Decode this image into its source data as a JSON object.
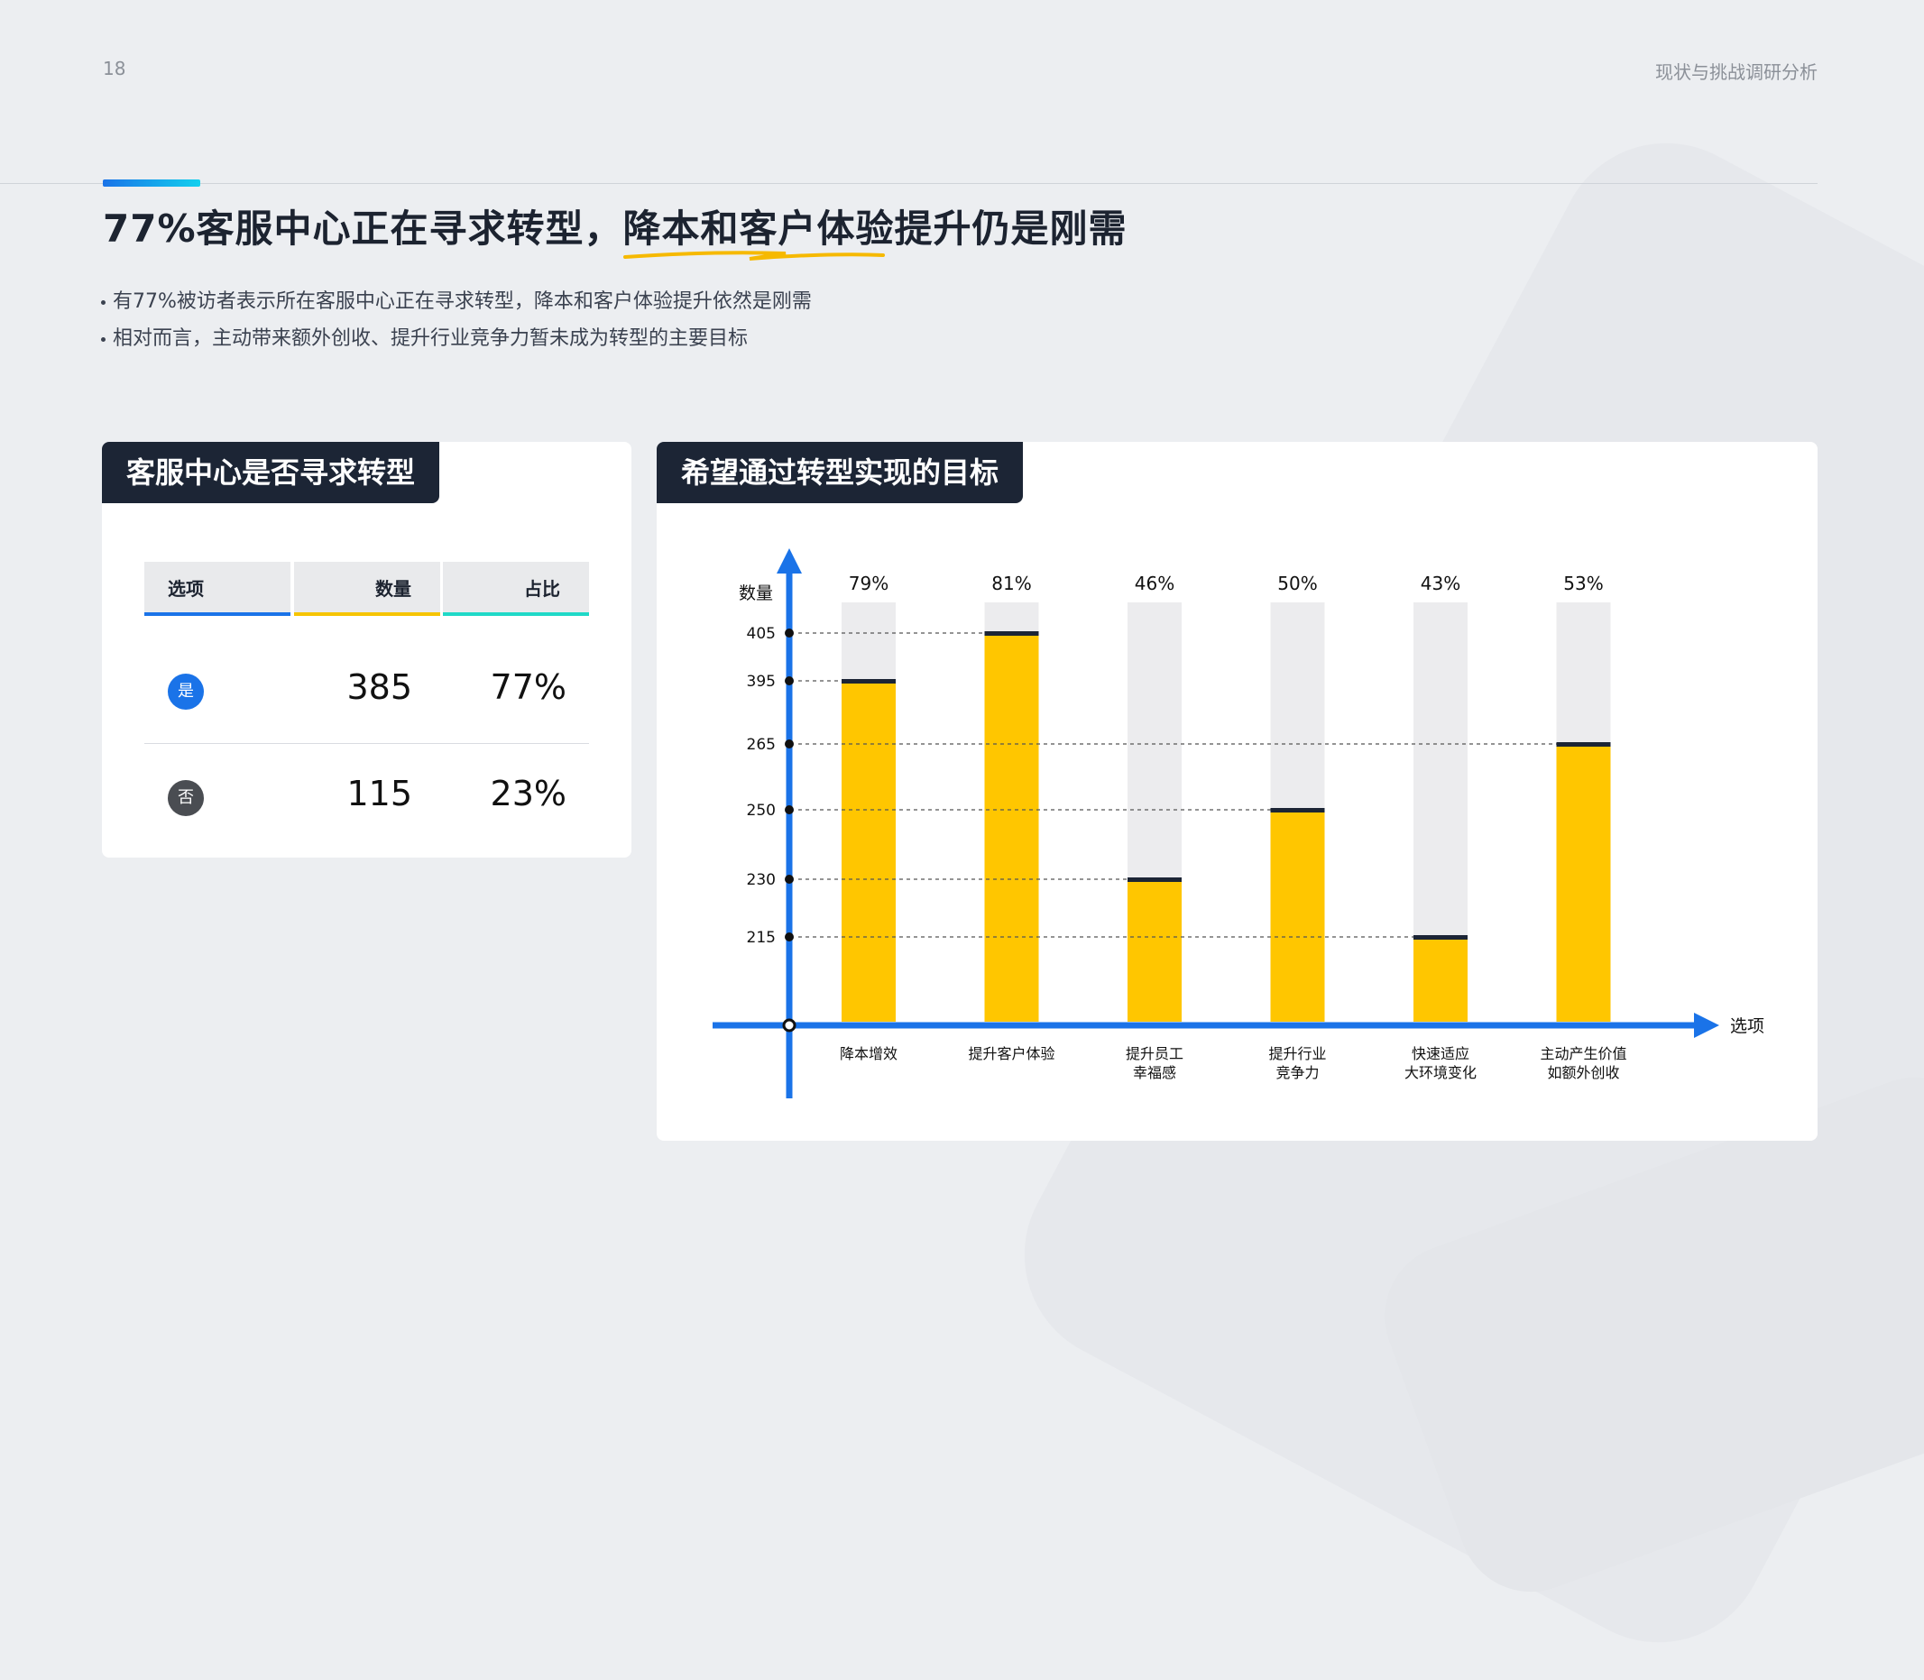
{
  "header": {
    "page_number": "18",
    "section_label": "现状与挑战调研分析"
  },
  "headline": {
    "part1": "77%客服中心正在寻求转型，",
    "part2": "降本和客户体验提升仍是刚需"
  },
  "bullets": [
    "有77%被访者表示所在客服中心正在寻求转型，降本和客户体验提升依然是刚需",
    "相对而言，主动带来额外创收、提升行业竞争力暂未成为转型的主要目标"
  ],
  "left_card": {
    "title": "客服中心是否寻求转型",
    "columns": [
      "选项",
      "数量",
      "占比"
    ],
    "column_colors": [
      "#1a73e8",
      "#f6c400",
      "#1fd9c7"
    ],
    "rows": [
      {
        "option": "是",
        "count": "385",
        "percent": "77%",
        "badge_color": "#1a73e8"
      },
      {
        "option": "否",
        "count": "115",
        "percent": "23%",
        "badge_color": "#4a4d52"
      }
    ]
  },
  "right_card": {
    "title": "希望通过转型实现的目标"
  },
  "chart_data": {
    "type": "bar",
    "ylabel": "数量",
    "xlabel": "选项",
    "categories": [
      [
        "降本增效"
      ],
      [
        "提升客户体验"
      ],
      [
        "提升员工",
        "幸福感"
      ],
      [
        "提升行业",
        "竞争力"
      ],
      [
        "快速适应",
        "大环境变化"
      ],
      [
        "主动产生价值",
        "如额外创收"
      ]
    ],
    "values": [
      395,
      405,
      230,
      250,
      215,
      265
    ],
    "percent_labels": [
      "79%",
      "81%",
      "46%",
      "50%",
      "43%",
      "53%"
    ],
    "yticks": [
      405,
      395,
      265,
      250,
      230,
      215
    ],
    "bar_color": "#ffc600",
    "track_color": "#ececee",
    "axis_color": "#1a73e8"
  }
}
